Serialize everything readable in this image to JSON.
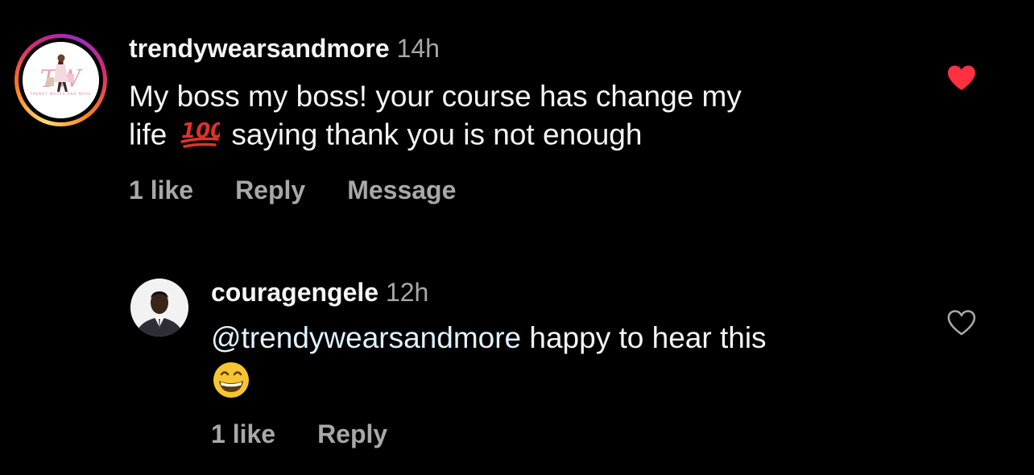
{
  "comments": [
    {
      "username": "trendywearsandmore",
      "time": "14h",
      "text_line1": "My boss my boss! your course has change my",
      "text_line2_before": "life",
      "text_line2_emoji": "hundred-points-emoji",
      "text_line2_after": "saying thank you is not enough",
      "avatar_logo": "TW",
      "likes": "1 like",
      "reply_label": "Reply",
      "message_label": "Message",
      "liked": true,
      "like_color": "#ff3040"
    },
    {
      "username": "couragengele",
      "time": "12h",
      "mention": "@trendywearsandmore",
      "text": "happy to hear this",
      "emoji": "grinning-face-emoji",
      "likes": "1 like",
      "reply_label": "Reply",
      "liked": false
    }
  ],
  "colors": {
    "background": "#000000",
    "primary_text": "#f5f5f5",
    "secondary_text": "#a8a8a8",
    "mention": "#e0f1ff",
    "like_red": "#ff3040"
  }
}
